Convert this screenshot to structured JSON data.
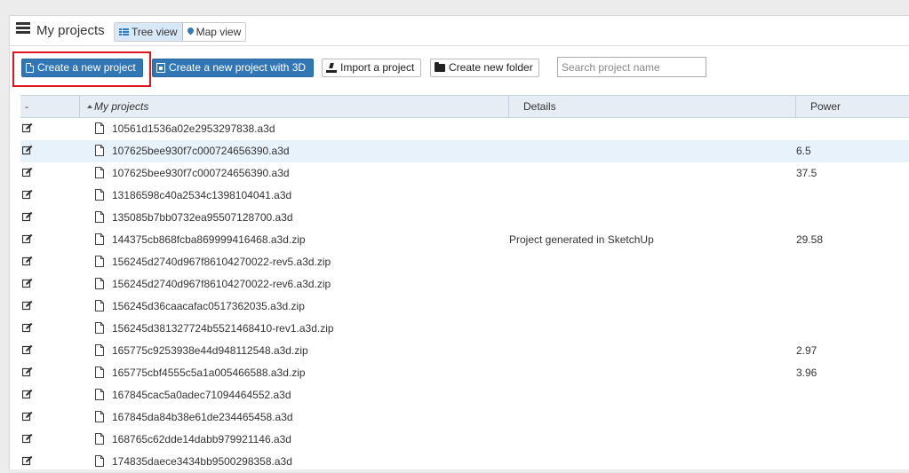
{
  "header": {
    "title": "My projects",
    "views": [
      {
        "label": "Tree view",
        "icon": "table-icon",
        "active": true
      },
      {
        "label": "Map view",
        "icon": "map-pin-icon",
        "active": false
      }
    ]
  },
  "toolbar": {
    "create_project": "Create a new project",
    "create_project_3d": "Create a new project with 3D",
    "import_project": "Import a project",
    "create_folder": "Create new folder",
    "search_placeholder": "Search project name"
  },
  "table": {
    "columns": [
      "-",
      "My projects",
      "Details",
      "Power"
    ],
    "rows": [
      {
        "name": "10561d1536a02e2953297838.a3d",
        "details": "",
        "power": ""
      },
      {
        "name": "107625bee930f7c000724656390.a3d",
        "details": "",
        "power": "6.5"
      },
      {
        "name": "107625bee930f7c000724656390.a3d",
        "details": "",
        "power": "37.5"
      },
      {
        "name": "13186598c40a2534c1398104041.a3d",
        "details": "",
        "power": ""
      },
      {
        "name": "135085b7bb0732ea95507128700.a3d",
        "details": "",
        "power": ""
      },
      {
        "name": "144375cb868fcba869999416468.a3d.zip",
        "details": "Project generated in SketchUp",
        "power": "29.58"
      },
      {
        "name": "156245d2740d967f86104270022-rev5.a3d.zip",
        "details": "",
        "power": ""
      },
      {
        "name": "156245d2740d967f86104270022-rev6.a3d.zip",
        "details": "",
        "power": ""
      },
      {
        "name": "156245d36caacafac0517362035.a3d.zip",
        "details": "",
        "power": ""
      },
      {
        "name": "156245d381327724b5521468410-rev1.a3d.zip",
        "details": "",
        "power": ""
      },
      {
        "name": "165775c9253938e44d948112548.a3d.zip",
        "details": "",
        "power": "2.97"
      },
      {
        "name": "165775cbf4555c5a1a005466588.a3d.zip",
        "details": "",
        "power": "3.96"
      },
      {
        "name": "167845cac5a0adec71094464552.a3d",
        "details": "",
        "power": ""
      },
      {
        "name": "167845da84b38e61de234465458.a3d",
        "details": "",
        "power": ""
      },
      {
        "name": "168765c62dde14dabb979921146.a3d",
        "details": "",
        "power": ""
      },
      {
        "name": "174835daece3434bb9500298358.a3d",
        "details": "",
        "power": ""
      }
    ]
  },
  "colors": {
    "primary_button": "#3277b5",
    "highlight_border": "#e1141d",
    "header_bg": "#e6edf5",
    "selected_row": "#e8f2fb"
  }
}
